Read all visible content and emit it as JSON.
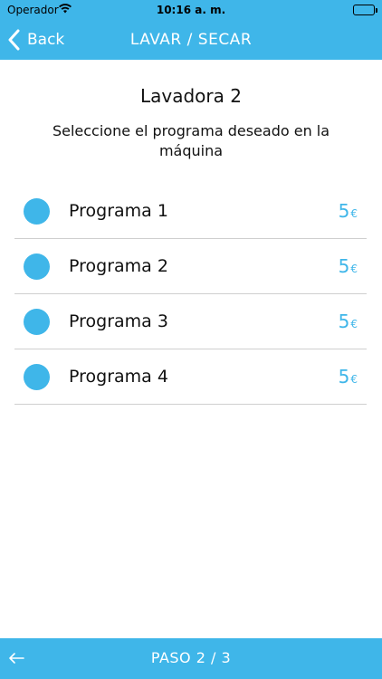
{
  "status": {
    "carrier": "Operador",
    "time": "10:16 a. m."
  },
  "nav": {
    "back_label": "Back",
    "title": "LAVAR / SECAR"
  },
  "main": {
    "machine_title": "Lavadora 2",
    "instruction": "Seleccione el programa deseado en la máquina"
  },
  "programs": [
    {
      "name": "Programa 1",
      "price": "5",
      "currency": "€"
    },
    {
      "name": "Programa 2",
      "price": "5",
      "currency": "€"
    },
    {
      "name": "Programa 3",
      "price": "5",
      "currency": "€"
    },
    {
      "name": "Programa 4",
      "price": "5",
      "currency": "€"
    }
  ],
  "footer": {
    "step": "PASO 2 / 3"
  },
  "colors": {
    "accent": "#3fb6e9"
  }
}
